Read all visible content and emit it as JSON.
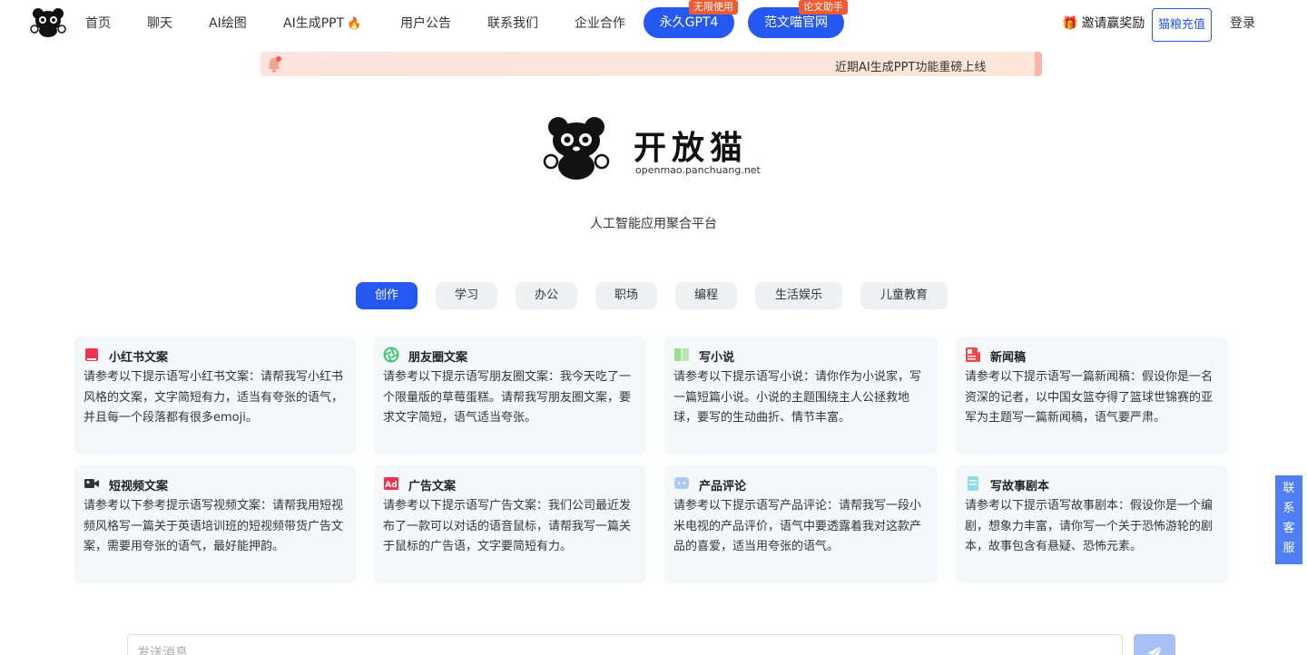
{
  "nav": {
    "items": [
      {
        "label": "首页"
      },
      {
        "label": "聊天"
      },
      {
        "label": "AI绘图"
      },
      {
        "label": "AI生成PPT"
      },
      {
        "label": "用户公告"
      },
      {
        "label": "联系我们"
      },
      {
        "label": "企业合作"
      }
    ],
    "pills": [
      {
        "label": "永久GPT4",
        "badge": "无限使用"
      },
      {
        "label": "范文喵官网",
        "badge": "论文助手"
      }
    ],
    "invite": "邀请赢奖励",
    "recharge": "猫粮充值",
    "login": "登录"
  },
  "notice": {
    "text": "近期AI生成PPT功能重磅上线"
  },
  "hero": {
    "name": "开放猫",
    "domain": "openmao.panchuang.net",
    "tagline": "人工智能应用聚合平台"
  },
  "tabs": [
    {
      "label": "创作",
      "active": true
    },
    {
      "label": "学习"
    },
    {
      "label": "办公"
    },
    {
      "label": "职场"
    },
    {
      "label": "编程"
    },
    {
      "label": "生活娱乐"
    },
    {
      "label": "儿童教育"
    }
  ],
  "cards": [
    {
      "title": "小红书文案",
      "icon": "xiaohongshu-book-icon",
      "color": "#f0334f",
      "body": "请参考以下提示语写小红书文案：请帮我写小红书风格的文案，文字简短有力，适当有夸张的语气，并且每一个段落都有很多emoji。"
    },
    {
      "title": "朋友圈文案",
      "icon": "moments-aperture-icon",
      "color": "#3cc86e",
      "body": "请参考以下提示语写朋友圈文案：我今天吃了一个限量版的草莓蛋糕。请帮我写朋友圈文案，要求文字简短，语气适当夸张。"
    },
    {
      "title": "写小说",
      "icon": "open-book-icon",
      "color": "#9bdc8e",
      "body": "请参考以下提示语写小说：请你作为小说家，写一篇短篇小说。小说的主题围绕主人公拯救地球，要写的生动曲折、情节丰富。"
    },
    {
      "title": "新闻稿",
      "icon": "newspaper-icon",
      "color": "#f04848",
      "body": "请参考以下提示语写一篇新闻稿：假设你是一名资深的记者，以中国女篮夺得了篮球世锦赛的亚军为主题写一篇新闻稿，语气要严肃。"
    },
    {
      "title": "短视频文案",
      "icon": "video-camera-icon",
      "color": "#333333",
      "body": "请参考以下参考提示语写视频文案：请帮我用短视频风格写一篇关于英语培训班的短视频带货广告文案，需要用夸张的语气，最好能押韵。"
    },
    {
      "title": "广告文案",
      "icon": "ad-icon",
      "color": "#f0334f",
      "body": "请参考以下提示语写广告文案：我们公司最近发布了一款可以对话的语音鼠标，请帮我写一篇关于鼠标的广告语，文字要简短有力。"
    },
    {
      "title": "产品评论",
      "icon": "chat-bubble-icon",
      "color": "#a9c8f2",
      "body": "请参考以下提示语写产品评论：请帮我写一段小米电视的产品评价，语气中要透露着我对这款产品的喜爱，适当用夸张的语气。"
    },
    {
      "title": "写故事剧本",
      "icon": "script-scroll-icon",
      "color": "#8fdde8",
      "body": "请参考以下提示语写故事剧本：假设你是一个编剧，想象力丰富，请你写一个关于恐怖游轮的剧本，故事包含有悬疑、恐怖元素。"
    }
  ],
  "contact": "联系客服",
  "input": {
    "placeholder": "发送消息"
  },
  "colors": {
    "accent": "#2458f0",
    "badge": "#f05a30"
  }
}
